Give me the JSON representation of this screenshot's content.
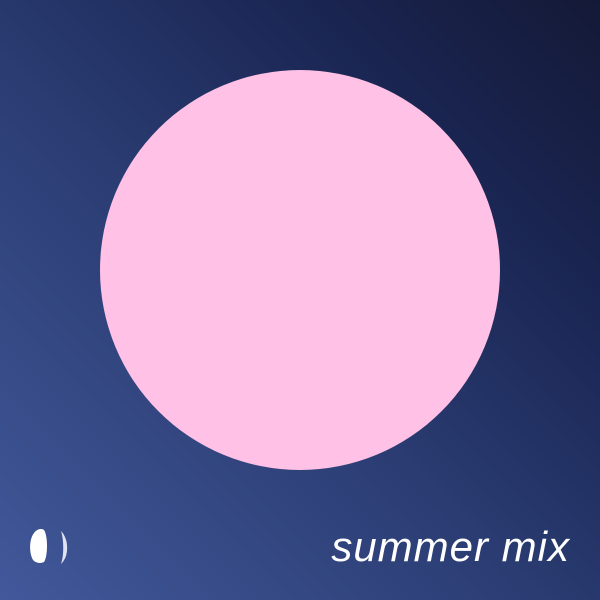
{
  "cover": {
    "title": "summer mix",
    "logo_icon": "moon-phase-logo",
    "colors": {
      "circle": "#ffc1e6",
      "gradient_light": "#42589a",
      "gradient_dark": "#141936",
      "text": "#ffffff"
    }
  }
}
